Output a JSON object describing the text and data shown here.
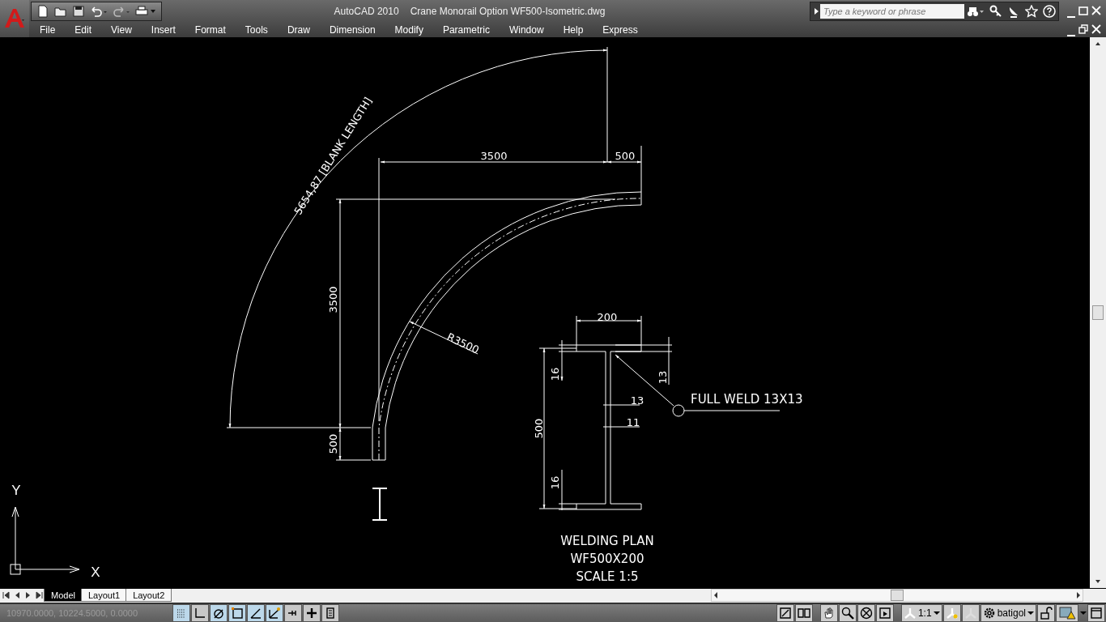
{
  "window": {
    "app": "AutoCAD 2010",
    "document": "Crane Monorail Option WF500-Isometric.dwg"
  },
  "search": {
    "placeholder": "Type a keyword or phrase"
  },
  "menu": [
    "File",
    "Edit",
    "View",
    "Insert",
    "Format",
    "Tools",
    "Draw",
    "Dimension",
    "Modify",
    "Parametric",
    "Window",
    "Help",
    "Express"
  ],
  "drawing": {
    "labels": [
      {
        "kind": "aligned",
        "text": "5654,87 [BLANK LENGTH]"
      },
      {
        "kind": "dim",
        "text": "3500"
      },
      {
        "kind": "dim",
        "text": "500"
      },
      {
        "kind": "dim",
        "text": "3500"
      },
      {
        "kind": "dim",
        "text": "500"
      },
      {
        "kind": "dim",
        "text": "R3500"
      },
      {
        "kind": "dim",
        "text": "200"
      },
      {
        "kind": "dim",
        "text": "16"
      },
      {
        "kind": "dim",
        "text": "13"
      },
      {
        "kind": "dim",
        "text": "13"
      },
      {
        "kind": "dim",
        "text": "11"
      },
      {
        "kind": "dim",
        "text": "500"
      },
      {
        "kind": "dim",
        "text": "16"
      },
      {
        "kind": "note",
        "text": "FULL WELD 13X13"
      },
      {
        "kind": "title",
        "text": "WELDING PLAN"
      },
      {
        "kind": "title",
        "text": "WF500X200"
      },
      {
        "kind": "title",
        "text": "SCALE 1:5"
      }
    ],
    "ucs": {
      "x": "X",
      "y": "Y"
    }
  },
  "layout_tabs": [
    {
      "label": "Model",
      "selected": true
    },
    {
      "label": "Layout1",
      "selected": false
    },
    {
      "label": "Layout2",
      "selected": false
    }
  ],
  "status_bar": {
    "coordinates": "10970.0000, 10224.5000, 0.0000",
    "toggles": [
      {
        "kind": "grid",
        "on": true
      },
      {
        "kind": "ortho",
        "on": false
      },
      {
        "kind": "polar",
        "on": true
      },
      {
        "kind": "osnap",
        "on": true
      },
      {
        "kind": "otrack",
        "on": true
      },
      {
        "kind": "ducs",
        "on": true
      },
      {
        "kind": "dyn",
        "on": false
      },
      {
        "kind": "lwt",
        "on": false
      },
      {
        "kind": "qp",
        "on": false
      }
    ],
    "annotation_scale": "1:1",
    "workspace": "batigol"
  }
}
